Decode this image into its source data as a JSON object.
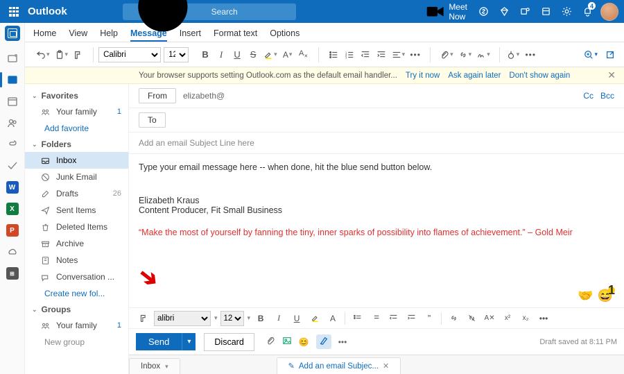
{
  "app_title": "Outlook",
  "search_placeholder": "Search",
  "meet_now": "Meet Now",
  "bell_count": "4",
  "tabs": [
    "Home",
    "View",
    "Help",
    "Message",
    "Insert",
    "Format text",
    "Options"
  ],
  "active_tab": "Message",
  "font_name": "Calibri",
  "font_size": "12",
  "banner": {
    "msg": "Your browser supports setting Outlook.com as the default email handler...",
    "try": "Try it now",
    "later": "Ask again later",
    "dont": "Don't show again"
  },
  "nav": {
    "favorites": "Favorites",
    "folders": "Folders",
    "groups": "Groups",
    "add_fav": "Add favorite",
    "create_folder": "Create new fol...",
    "new_group": "New group",
    "items": {
      "your_family": "Your family",
      "your_family_count": "1",
      "inbox": "Inbox",
      "junk": "Junk Email",
      "drafts": "Drafts",
      "drafts_count": "26",
      "sent": "Sent Items",
      "deleted": "Deleted Items",
      "archive": "Archive",
      "notes": "Notes",
      "conversation": "Conversation ..."
    }
  },
  "compose": {
    "from_label": "From",
    "from_value": "elizabeth@",
    "to_label": "To",
    "cc": "Cc",
    "bcc": "Bcc",
    "subject_placeholder": "Add an email Subject Line here",
    "body_placeholder": "Type your email message here -- when done, hit the blue send button below.",
    "sig_name": "Elizabeth Kraus",
    "sig_title": "Content Producer, Fit Small Business",
    "quote": "“Make the most of yourself by fanning the tiny, inner sparks of possibility into flames of achievement.” – Gold Meir"
  },
  "fmt_font": "alibri",
  "fmt_size": "12",
  "send": "Send",
  "discard": "Discard",
  "draft_saved": "Draft saved at 8:11 PM",
  "btm_tabs": {
    "inbox": "Inbox",
    "compose": "Add an email Subjec..."
  }
}
